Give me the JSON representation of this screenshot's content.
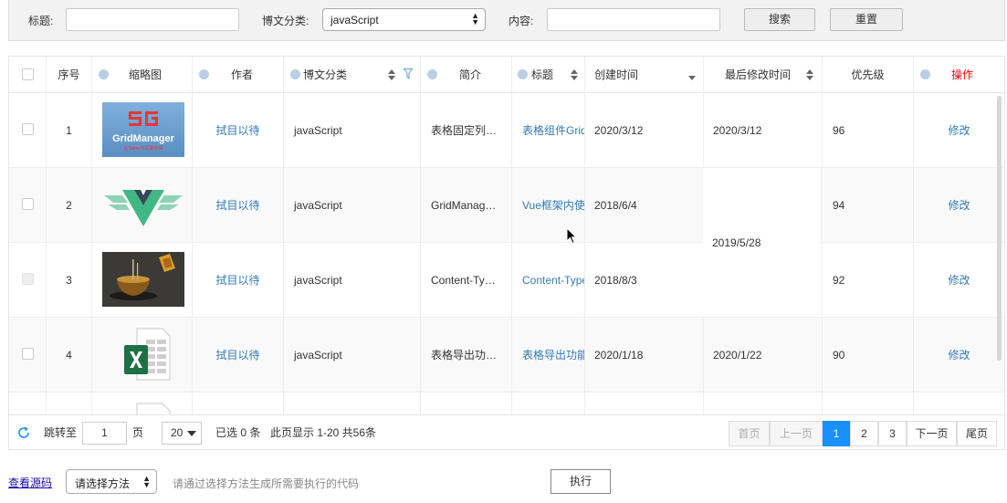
{
  "search": {
    "title_label": "标题:",
    "title_value": "",
    "category_label": "博文分类:",
    "category_value": "javaScript",
    "content_label": "内容:",
    "content_value": "",
    "search_button": "搜索",
    "reset_button": "重置"
  },
  "grid": {
    "columns": {
      "index": "序号",
      "thumb": "缩略图",
      "author": "作者",
      "category": "博文分类",
      "intro": "简介",
      "title": "标题",
      "created": "创建时间",
      "modified": "最后修改时间",
      "priority": "优先级",
      "action": "操作"
    },
    "rows": [
      {
        "index": "1",
        "thumb": "gridmanager-logo",
        "author": "拭目以待",
        "category": "javaScript",
        "intro": "表格固定列…",
        "title": "表格组件Grid",
        "created": "2020/3/12",
        "priority": "96",
        "action": "修改"
      },
      {
        "index": "2",
        "thumb": "vue-logo",
        "author": "拭目以待",
        "category": "javaScript",
        "intro": "GridManag…",
        "title": "Vue框架内使",
        "created": "2018/6/4",
        "priority": "94",
        "action": "修改"
      },
      {
        "index": "3",
        "thumb": "incense-burner-image",
        "author": "拭目以待",
        "category": "javaScript",
        "intro": "Content-Ty…",
        "title": "Content-Type",
        "created": "2018/8/3",
        "priority": "92",
        "action": "修改"
      },
      {
        "index": "4",
        "thumb": "excel-icon",
        "author": "拭目以待",
        "category": "javaScript",
        "intro": "表格导出功…",
        "title": "表格导出功能",
        "created": "2020/1/18",
        "priority": "90",
        "action": "修改"
      }
    ],
    "modified_row1": "2020/3/12",
    "modified_rows23": "2019/5/28",
    "modified_row4": "2020/1/22",
    "gridmanager_logo_text": "GridManager",
    "gridmanager_logo_sub": "让Table所见即所得",
    "colors": {
      "accent": "#1890ff",
      "link": "#337ab7",
      "action_header": "#ff0000"
    }
  },
  "footer": {
    "goto_label": "跳转至",
    "goto_value": "1",
    "page_unit": "页",
    "page_size": "20",
    "selected_info": "已选 0 条",
    "range_info": "此页显示 1-20 共56条",
    "first": "首页",
    "prev": "上一页",
    "pages": [
      "1",
      "2",
      "3"
    ],
    "next": "下一页",
    "last": "尾页"
  },
  "bottom": {
    "view_source": "查看源码",
    "method_select": "请选择方法",
    "hint": "请通过选择方法生成所需要执行的代码",
    "execute": "执行"
  }
}
